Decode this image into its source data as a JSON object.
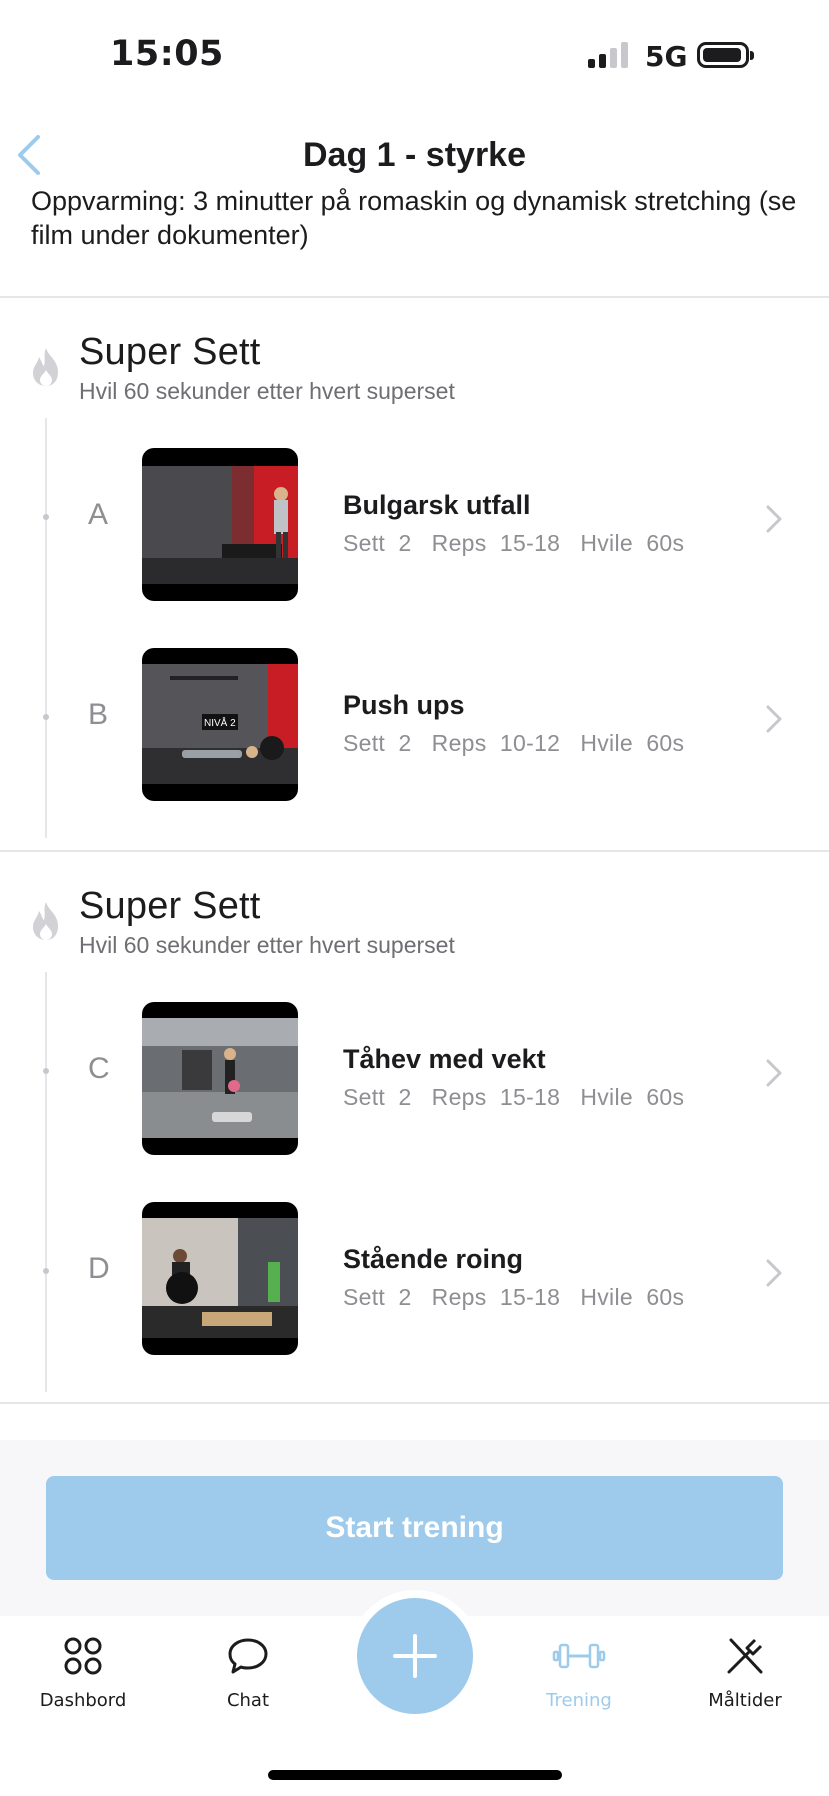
{
  "status_bar": {
    "time": "15:05",
    "network": "5G"
  },
  "header": {
    "title": "Dag 1 - styrke",
    "description": "Oppvarming: 3 minutter på romaskin og dynamisk stretching (se film under dokumenter)"
  },
  "supersets": [
    {
      "title": "Super Sett",
      "subtitle": "Hvil 60 sekunder etter hvert superset",
      "exercises": [
        {
          "letter": "A",
          "name": "Bulgarsk utfall",
          "meta": "Sett  2   Reps  15-18   Hvile  60s"
        },
        {
          "letter": "B",
          "name": "Push ups",
          "meta": "Sett  2   Reps  10-12   Hvile  60s",
          "thumb_text": "NIVÅ 2"
        }
      ]
    },
    {
      "title": "Super Sett",
      "subtitle": "Hvil 60 sekunder etter hvert superset",
      "exercises": [
        {
          "letter": "C",
          "name": "Tåhev med vekt",
          "meta": "Sett  2   Reps  15-18   Hvile  60s"
        },
        {
          "letter": "D",
          "name": "Stående roing",
          "meta": "Sett  2   Reps  15-18   Hvile  60s"
        }
      ]
    }
  ],
  "start_button": {
    "label": "Start trening"
  },
  "tabbar": {
    "tabs": [
      {
        "label": "Dashbord",
        "icon": "dashboard-grid-icon"
      },
      {
        "label": "Chat",
        "icon": "chat-bubble-icon"
      },
      {
        "label": "Trening",
        "icon": "dumbbell-icon",
        "active": true
      },
      {
        "label": "Måltider",
        "icon": "fork-knife-icon"
      }
    ],
    "fab_icon": "plus-icon"
  },
  "colors": {
    "accent": "#9ecbeb",
    "text": "#1c1c1e",
    "muted": "#8e8e93",
    "divider": "#e5e5ea"
  }
}
